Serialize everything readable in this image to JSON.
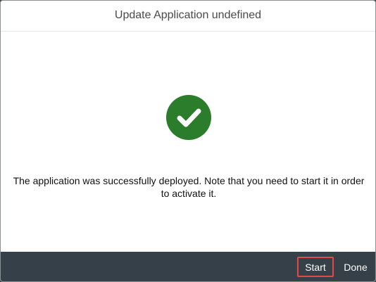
{
  "dialog": {
    "title": "Update Application undefined",
    "message": "The application was successfully deployed. Note that you need to start it in order to activate it.",
    "status_icon": "success-check-icon",
    "status_color": "#2b7c2b"
  },
  "footer": {
    "start_label": "Start",
    "done_label": "Done",
    "background_color": "#354048",
    "highlight_color": "#e24a4a"
  }
}
